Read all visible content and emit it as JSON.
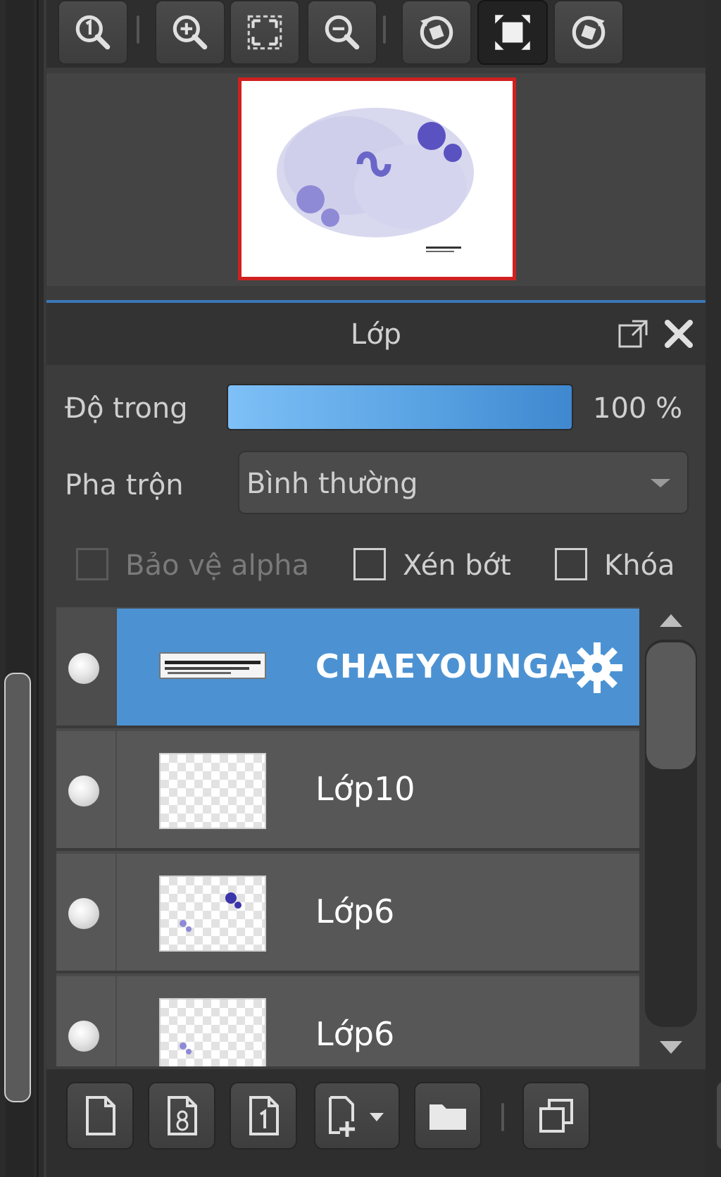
{
  "toolbar": {
    "buttons": [
      {
        "icon": "zoom-actual-size-icon"
      },
      {
        "icon": "zoom-in-icon"
      },
      {
        "icon": "fit-to-window-icon"
      },
      {
        "icon": "zoom-out-icon"
      },
      {
        "icon": "rotate-left-icon"
      },
      {
        "icon": "fullscreen-icon"
      },
      {
        "icon": "rotate-right-icon"
      }
    ]
  },
  "navigator": {
    "preview_border_color": "#d02020"
  },
  "layer_panel": {
    "title": "Lớp",
    "opacity": {
      "label": "Độ trong",
      "value_text": "100 %",
      "value": 100
    },
    "blend": {
      "label": "Pha trộn",
      "value": "Bình thường"
    },
    "options": [
      {
        "label": "Bảo vệ alpha",
        "checked": false,
        "enabled": false
      },
      {
        "label": "Xén bớt",
        "checked": false,
        "enabled": true
      },
      {
        "label": "Khóa",
        "checked": false,
        "enabled": true
      }
    ],
    "layers": [
      {
        "name": "CHAEYOUNGA",
        "selected": true,
        "thumb": "text"
      },
      {
        "name": "Lớp10",
        "selected": false,
        "thumb": "empty"
      },
      {
        "name": "Lớp6",
        "selected": false,
        "thumb": "dots"
      },
      {
        "name": "Lớp6",
        "selected": false,
        "thumb": "dot"
      }
    ]
  },
  "bottom_bar": {
    "buttons": [
      {
        "icon": "new-layer-icon"
      },
      {
        "icon": "new-8bit-layer-icon"
      },
      {
        "icon": "new-1bit-layer-icon"
      },
      {
        "icon": "add-layer-dropdown-icon"
      },
      {
        "icon": "new-folder-icon"
      },
      {
        "icon": "duplicate-layer-icon"
      }
    ]
  },
  "colors": {
    "accent": "#4c92d2",
    "highlight_line": "#3a78b8"
  }
}
